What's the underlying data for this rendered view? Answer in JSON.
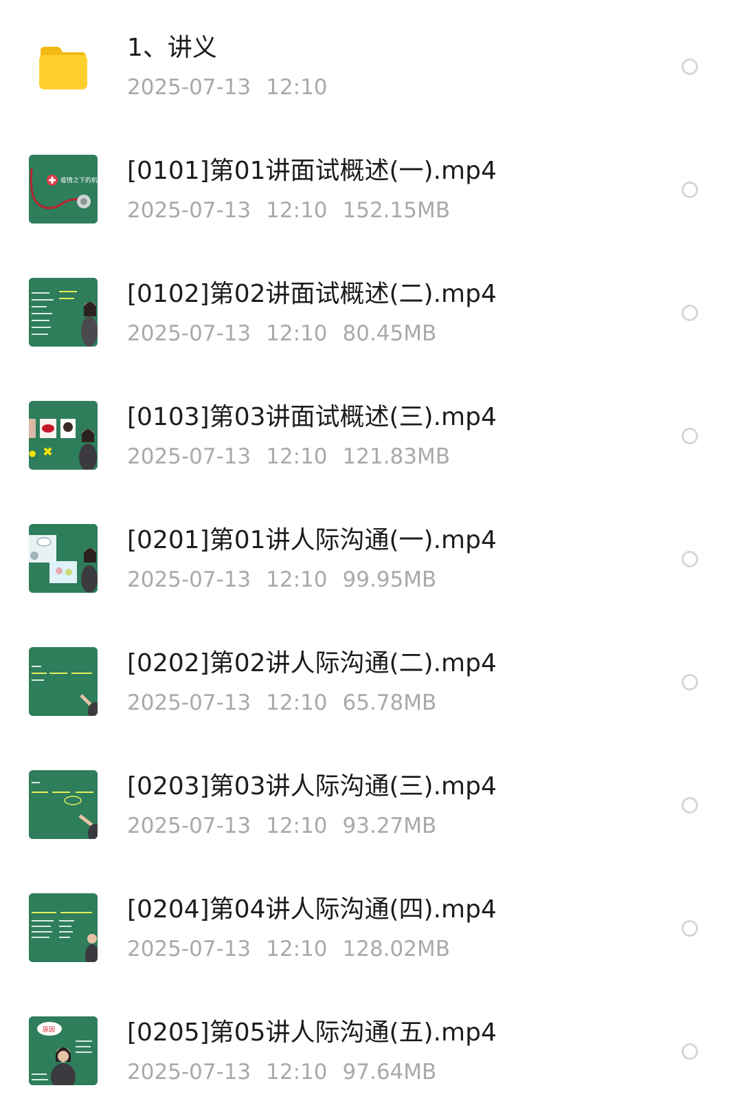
{
  "colors": {
    "folder": "#ffcf2e",
    "thumb_green": "#2e7d5b",
    "name_text": "#1c1c1c",
    "meta_text": "#a9a9ad",
    "radio_border": "#d6d6d9"
  },
  "files": [
    {
      "icon": "folder-icon",
      "name": "1、讲义",
      "date": "2025-07-13",
      "time": "12:10",
      "size": ""
    },
    {
      "icon": "video-thumbnail",
      "name": "[0101]第01讲面试概述(一).mp4",
      "date": "2025-07-13",
      "time": "12:10",
      "size": "152.15MB",
      "thumb_text": "疫情之下的机遇"
    },
    {
      "icon": "video-thumbnail",
      "name": "[0102]第02讲面试概述(二).mp4",
      "date": "2025-07-13",
      "time": "12:10",
      "size": "80.45MB"
    },
    {
      "icon": "video-thumbnail",
      "name": "[0103]第03讲面试概述(三).mp4",
      "date": "2025-07-13",
      "time": "12:10",
      "size": "121.83MB"
    },
    {
      "icon": "video-thumbnail",
      "name": "[0201]第01讲人际沟通(一).mp4",
      "date": "2025-07-13",
      "time": "12:10",
      "size": "99.95MB"
    },
    {
      "icon": "video-thumbnail",
      "name": "[0202]第02讲人际沟通(二).mp4",
      "date": "2025-07-13",
      "time": "12:10",
      "size": "65.78MB"
    },
    {
      "icon": "video-thumbnail",
      "name": "[0203]第03讲人际沟通(三).mp4",
      "date": "2025-07-13",
      "time": "12:10",
      "size": "93.27MB"
    },
    {
      "icon": "video-thumbnail",
      "name": "[0204]第04讲人际沟通(四).mp4",
      "date": "2025-07-13",
      "time": "12:10",
      "size": "128.02MB"
    },
    {
      "icon": "video-thumbnail",
      "name": "[0205]第05讲人际沟通(五).mp4",
      "date": "2025-07-13",
      "time": "12:10",
      "size": "97.64MB",
      "thumb_text": "原因"
    }
  ]
}
